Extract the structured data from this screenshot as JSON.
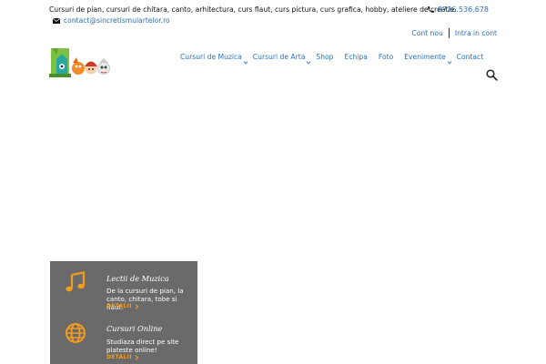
{
  "topbar": {
    "tagline": "Cursuri de pian, cursuri de chitara, canto, arhitectura, curs flaut, curs pictura, curs grafica, hobby, ateliere de creatie.",
    "phone": "0726.536.678",
    "email": "contact@sincretismulartelor.ro",
    "account": {
      "new_account": "Cont nou",
      "login": "Intra in cont"
    }
  },
  "icons": {
    "phone": "phone-icon",
    "email": "envelope-icon",
    "search": "search-icon",
    "caret": "chevron-down-icon",
    "music": "music-note-icon",
    "globe": "globe-icon"
  },
  "colors": {
    "link": "#2a70b8",
    "panel": "#6a6a6a",
    "accent": "#f39c1f"
  },
  "nav": {
    "items": [
      {
        "label": "Cursuri de Muzica"
      },
      {
        "label": "Cursuri de Arta"
      },
      {
        "label": "Shop"
      },
      {
        "label": "Echipa"
      },
      {
        "label": "Foto"
      },
      {
        "label": "Evenimente"
      },
      {
        "label": "Contact"
      }
    ]
  },
  "features": [
    {
      "title": "Lectii de Muzica",
      "description": "De la cursuri de pian, la canto, chitara, tobe si flaut.",
      "more": "DETALII"
    },
    {
      "title": "Cursuri Online",
      "description": "Studiaza direct pe site plateste online!",
      "more": "DETALII"
    }
  ]
}
